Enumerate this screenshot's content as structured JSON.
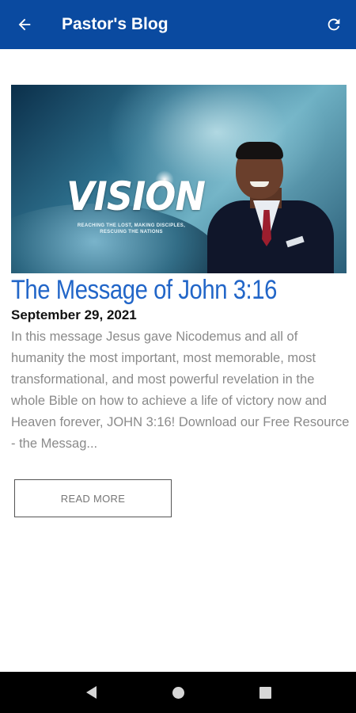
{
  "app_bar": {
    "title": "Pastor's Blog",
    "back_icon": "arrow-left-icon",
    "refresh_icon": "refresh-icon",
    "background_color": "#0a4aa0"
  },
  "post": {
    "hero_image": {
      "icon": "blog-hero-image",
      "headline": "VISION",
      "tagline": "REACHING THE LOST, MAKING DISCIPLES, RESCUING THE NATIONS"
    },
    "title": "The Message of John 3:16",
    "date": "September 29, 2021",
    "excerpt": "In this message Jesus gave Nicodemus and all of humanity the most important, most memorable, most transformational, and most powerful revelation in the whole Bible on how to achieve a life of victory now and Heaven forever, JOHN 3:16! Download our Free Resource - the Messag...",
    "read_more_label": "READ MORE",
    "title_color": "#2266c8"
  },
  "system_nav": {
    "back_icon": "nav-back-triangle-icon",
    "home_icon": "nav-home-circle-icon",
    "recents_icon": "nav-recents-square-icon"
  }
}
